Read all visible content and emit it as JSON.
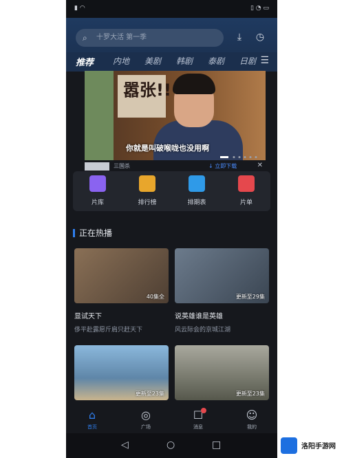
{
  "search": {
    "placeholder": "十罗大活 第一季"
  },
  "tabs": [
    "推荐",
    "内地",
    "美剧",
    "韩剧",
    "泰剧",
    "日剧"
  ],
  "banner": {
    "subtitle": "你就是叫破喉咙也没用啊",
    "poster_text": "嚣张!!"
  },
  "ad": {
    "name": "三国杀",
    "download_label": "立即下载"
  },
  "menu": [
    {
      "label": "片库",
      "icon": "library-icon",
      "color": "#8a63f0"
    },
    {
      "label": "排行榜",
      "icon": "ranking-icon",
      "color": "#e8a62c"
    },
    {
      "label": "排期表",
      "icon": "calendar-icon",
      "color": "#2f9ae8"
    },
    {
      "label": "片单",
      "icon": "playlist-icon",
      "color": "#e5484d"
    }
  ],
  "section": {
    "title": "正在热播"
  },
  "cards": [
    {
      "title": "显试天下",
      "desc": "侈平赴露愿斤肩只赶天下",
      "badge": "40集全",
      "bg": "#6f5a46"
    },
    {
      "title": "说英雄谁是英雄",
      "desc": "风云际会的京城江湖",
      "badge": "更新至29集",
      "bg": "#4c5a6a"
    },
    {
      "title": "",
      "desc": "",
      "badge": "更新至23集",
      "bg": "#5f86a8"
    },
    {
      "title": "",
      "desc": "",
      "badge": "更新至23集",
      "bg": "#56584c"
    }
  ],
  "bottom_nav": [
    {
      "label": "首页",
      "icon": "home-icon",
      "active": true
    },
    {
      "label": "广场",
      "icon": "discover-icon",
      "active": false
    },
    {
      "label": "消息",
      "icon": "message-icon",
      "active": false
    },
    {
      "label": "我的",
      "icon": "profile-icon",
      "active": false
    }
  ],
  "watermark": {
    "text": "洛阳手游网"
  }
}
